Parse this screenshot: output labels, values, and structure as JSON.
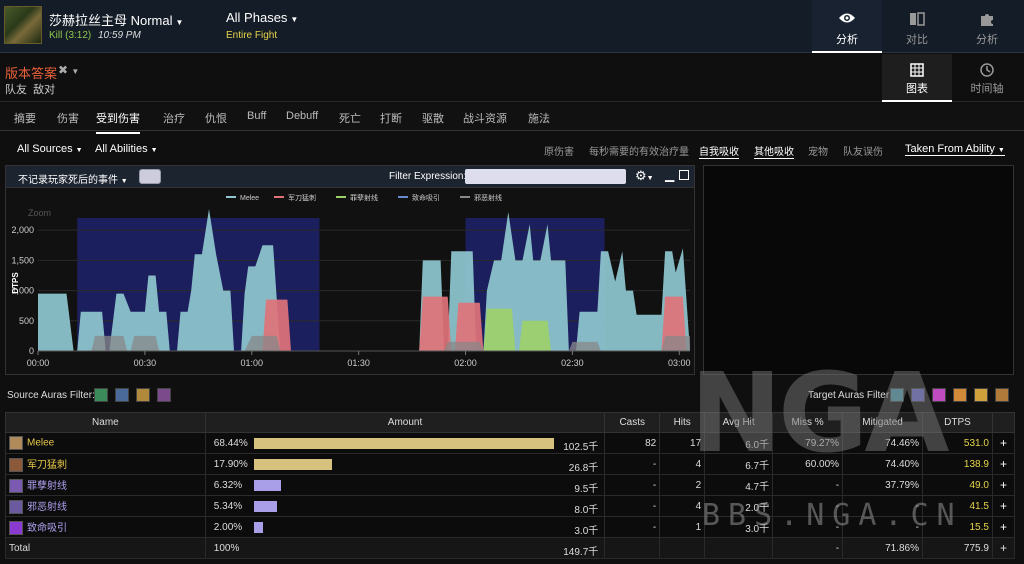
{
  "header": {
    "boss_name": "莎赫拉丝主母 Normal",
    "kill_status": "Kill (3:12)",
    "kill_time": "10:59 PM",
    "phase": "All Phases",
    "phase_sub": "Entire Fight",
    "nav": [
      {
        "label": "分析",
        "icon": "eye-icon",
        "active": true
      },
      {
        "label": "对比",
        "icon": "compare-icon",
        "active": false
      },
      {
        "label": "分析",
        "icon": "puzzle-icon",
        "active": false
      }
    ]
  },
  "subheader": {
    "version": "版本答案",
    "filters": [
      "队友",
      "敌对"
    ],
    "views": [
      {
        "label": "图表",
        "icon": "grid-icon",
        "active": true
      },
      {
        "label": "时间轴",
        "icon": "clock-icon",
        "active": false
      }
    ]
  },
  "tabs": [
    "摘要",
    "伤害",
    "受到伤害",
    "治疗",
    "仇恨",
    "Buff",
    "Debuff",
    "死亡",
    "打断",
    "驱散",
    "战斗资源",
    "施法"
  ],
  "active_tab": "受到伤害",
  "filterbar": {
    "sources": "All Sources",
    "abilities": "All Abilities",
    "options": [
      "原伤害",
      "每秒需要的有效治疗量",
      "自我吸收",
      "其他吸收",
      "宠物",
      "队友误伤"
    ],
    "active_options": [
      "自我吸收",
      "其他吸收"
    ],
    "taken_from": "Taken From Ability"
  },
  "chart_header": {
    "checkbox_label": "不记录玩家死后的事件",
    "filter_label": "Filter Expression:"
  },
  "chart_data": {
    "type": "area",
    "ylabel": "DTPS",
    "zoom_label": "Zoom",
    "ylim": [
      0,
      2400
    ],
    "yticks": [
      "0",
      "500",
      "1,000",
      "1,500",
      "2,000"
    ],
    "xticks": [
      "00:00",
      "00:30",
      "01:00",
      "01:30",
      "02:00",
      "02:30",
      "03:00"
    ],
    "legend_placement": "top-center",
    "phase_bands_sec": [
      [
        11,
        79
      ],
      [
        120,
        159
      ]
    ],
    "series": [
      {
        "name": "Melee",
        "color": "#8fc8d0",
        "points": [
          [
            0,
            950
          ],
          [
            8,
            950
          ],
          [
            10,
            0
          ],
          [
            11,
            0
          ],
          [
            12,
            650
          ],
          [
            18,
            650
          ],
          [
            19,
            0
          ],
          [
            20,
            0
          ],
          [
            22,
            950
          ],
          [
            24,
            950
          ],
          [
            26,
            650
          ],
          [
            30,
            650
          ],
          [
            31,
            1250
          ],
          [
            33,
            1250
          ],
          [
            34,
            650
          ],
          [
            36,
            650
          ],
          [
            37,
            0
          ],
          [
            39,
            0
          ],
          [
            40,
            650
          ],
          [
            42,
            650
          ],
          [
            43,
            1000
          ],
          [
            44,
            1600
          ],
          [
            46,
            1600
          ],
          [
            48,
            2350
          ],
          [
            50,
            1600
          ],
          [
            52,
            1000
          ],
          [
            54,
            1000
          ],
          [
            55,
            0
          ],
          [
            57,
            0
          ],
          [
            58,
            950
          ],
          [
            59,
            1400
          ],
          [
            61,
            1400
          ],
          [
            63,
            1750
          ],
          [
            66,
            1750
          ],
          [
            68,
            0
          ],
          [
            107,
            0
          ],
          [
            108,
            1500
          ],
          [
            113,
            1500
          ],
          [
            114,
            0
          ],
          [
            115,
            0
          ],
          [
            116,
            1650
          ],
          [
            122,
            1650
          ],
          [
            123,
            0
          ],
          [
            125,
            0
          ],
          [
            126,
            1000
          ],
          [
            128,
            1500
          ],
          [
            130,
            1500
          ],
          [
            132,
            2300
          ],
          [
            134,
            1500
          ],
          [
            136,
            1500
          ],
          [
            138,
            2100
          ],
          [
            139,
            1500
          ],
          [
            141,
            1500
          ],
          [
            143,
            2100
          ],
          [
            144,
            1500
          ],
          [
            148,
            1500
          ],
          [
            149,
            0
          ],
          [
            151,
            0
          ],
          [
            152,
            650
          ],
          [
            157,
            650
          ],
          [
            158,
            1650
          ],
          [
            160,
            1650
          ],
          [
            162,
            1150
          ],
          [
            164,
            1650
          ],
          [
            165,
            1000
          ],
          [
            167,
            1000
          ],
          [
            168,
            600
          ],
          [
            175,
            600
          ],
          [
            176,
            1650
          ],
          [
            178,
            1650
          ],
          [
            179,
            1300
          ],
          [
            181,
            1700
          ],
          [
            183,
            0
          ]
        ]
      },
      {
        "name": "军刀猛刺",
        "color": "#e0737a",
        "points": [
          [
            0,
            0
          ],
          [
            63,
            0
          ],
          [
            64,
            850
          ],
          [
            70,
            850
          ],
          [
            71,
            0
          ],
          [
            107,
            0
          ],
          [
            108,
            900
          ],
          [
            115,
            900
          ],
          [
            116,
            0
          ],
          [
            117,
            0
          ],
          [
            118,
            800
          ],
          [
            124,
            800
          ],
          [
            125,
            0
          ],
          [
            175,
            0
          ],
          [
            176,
            900
          ],
          [
            181,
            900
          ],
          [
            182,
            0
          ],
          [
            183,
            0
          ]
        ]
      },
      {
        "name": "罪孽射线",
        "color": "#9ed06a",
        "points": [
          [
            0,
            0
          ],
          [
            125,
            0
          ],
          [
            126,
            700
          ],
          [
            133,
            700
          ],
          [
            134,
            0
          ],
          [
            135,
            0
          ],
          [
            136,
            500
          ],
          [
            143,
            500
          ],
          [
            144,
            0
          ],
          [
            183,
            0
          ]
        ]
      },
      {
        "name": "致命吸引",
        "color": "#6a8ad0",
        "points": [
          [
            0,
            0
          ],
          [
            183,
            0
          ]
        ]
      },
      {
        "name": "邪恶射线",
        "color": "#888888",
        "points": [
          [
            0,
            0
          ],
          [
            15,
            0
          ],
          [
            16,
            250
          ],
          [
            24,
            250
          ],
          [
            25,
            0
          ],
          [
            26,
            0
          ],
          [
            27,
            250
          ],
          [
            33,
            250
          ],
          [
            34,
            0
          ],
          [
            58,
            0
          ],
          [
            60,
            250
          ],
          [
            67,
            250
          ],
          [
            68,
            0
          ],
          [
            114,
            0
          ],
          [
            115,
            150
          ],
          [
            124,
            150
          ],
          [
            125,
            0
          ],
          [
            149,
            0
          ],
          [
            150,
            150
          ],
          [
            157,
            150
          ],
          [
            158,
            0
          ],
          [
            175,
            0
          ],
          [
            176,
            250
          ],
          [
            183,
            250
          ]
        ]
      }
    ]
  },
  "auras": {
    "source_label": "Source Auras Filter:",
    "target_label": "Target Auras Filter:",
    "source_icons": [
      {
        "name": "aura-icon",
        "color": "#3a8a5a"
      },
      {
        "name": "aura-icon",
        "color": "#4a6a9a"
      },
      {
        "name": "aura-icon",
        "color": "#b08a3a"
      },
      {
        "name": "aura-icon",
        "color": "#7a4a8a"
      }
    ],
    "target_icons": [
      {
        "name": "aura-icon",
        "color": "#4a9aaa"
      },
      {
        "name": "aura-icon",
        "color": "#6a6ad0"
      },
      {
        "name": "aura-icon",
        "color": "#c04ac0"
      },
      {
        "name": "aura-icon",
        "color": "#d08a3a"
      },
      {
        "name": "aura-icon",
        "color": "#d0a03a"
      },
      {
        "name": "aura-icon",
        "color": "#b07a3a"
      }
    ]
  },
  "table": {
    "columns": [
      "Name",
      "Amount",
      "Casts",
      "Hits",
      "Avg Hit",
      "Miss %",
      "Mitigated",
      "DTPS"
    ],
    "rows": [
      {
        "name": "Melee",
        "name_color": "#e6c84a",
        "icon_color": "#b08a5a",
        "pct": "68.44%",
        "fraction": 1.0,
        "bar_color": "#d6c27e",
        "amount": "102.5千",
        "casts": "82",
        "hits": "17",
        "avg": "6.0千",
        "miss": "79.27%",
        "mitigated": "74.46%",
        "dtps": "531.0"
      },
      {
        "name": "军刀猛刺",
        "name_color": "#e6c84a",
        "icon_color": "#8a5a3a",
        "pct": "17.90%",
        "fraction": 0.2615,
        "bar_color": "#d6c27e",
        "amount": "26.8千",
        "casts": "-",
        "hits": "4",
        "avg": "6.7千",
        "miss": "60.00%",
        "mitigated": "74.40%",
        "dtps": "138.9"
      },
      {
        "name": "罪孽射线",
        "name_color": "#b0a0f0",
        "icon_color": "#7a5ab0",
        "pct": "6.32%",
        "fraction": 0.0923,
        "bar_color": "#a99ee8",
        "amount": "9.5千",
        "casts": "-",
        "hits": "2",
        "avg": "4.7千",
        "miss": "-",
        "mitigated": "37.79%",
        "dtps": "49.0"
      },
      {
        "name": "邪恶射线",
        "name_color": "#b0a0f0",
        "icon_color": "#6a5aa0",
        "pct": "5.34%",
        "fraction": 0.078,
        "bar_color": "#a99ee8",
        "amount": "8.0千",
        "casts": "-",
        "hits": "4",
        "avg": "2.0千",
        "miss": "-",
        "mitigated": "-",
        "dtps": "41.5"
      },
      {
        "name": "致命吸引",
        "name_color": "#b0a0f0",
        "icon_color": "#8a3ad0",
        "pct": "2.00%",
        "fraction": 0.0293,
        "bar_color": "#a99ee8",
        "amount": "3.0千",
        "casts": "-",
        "hits": "1",
        "avg": "3.0千",
        "miss": "-",
        "mitigated": "-",
        "dtps": "15.5"
      }
    ],
    "total": {
      "name": "Total",
      "pct": "100%",
      "amount": "149.7千",
      "miss": "-",
      "mitigated": "71.86%",
      "dtps": "775.9"
    }
  },
  "watermark": {
    "big": "NGA",
    "small": "BBS.NGA.CN"
  }
}
